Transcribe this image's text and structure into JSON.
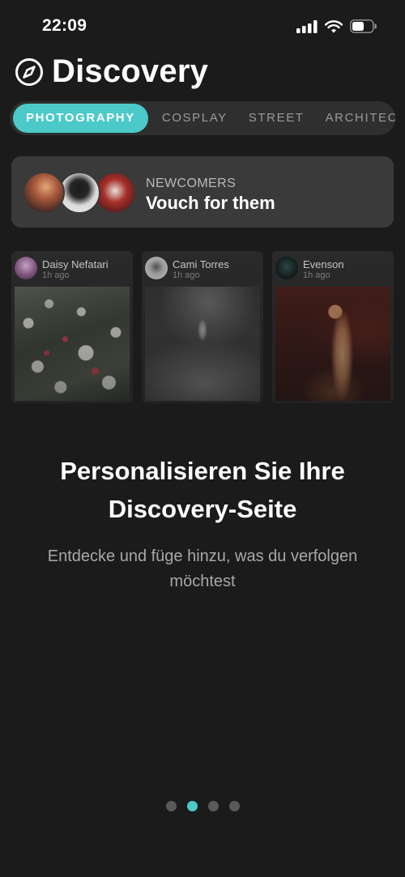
{
  "status_bar": {
    "time": "22:09"
  },
  "header": {
    "title": "Discovery",
    "icon": "compass-icon"
  },
  "tabs": [
    {
      "label": "PHOTOGRAPHY",
      "active": true
    },
    {
      "label": "COSPLAY",
      "active": false
    },
    {
      "label": "STREET",
      "active": false
    },
    {
      "label": "ARCHITEC",
      "active": false
    }
  ],
  "newcomers": {
    "label": "NEWCOMERS",
    "title": "Vouch for them"
  },
  "cards": [
    {
      "name": "Daisy Nefatari",
      "time": "1h ago"
    },
    {
      "name": "Cami Torres",
      "time": "1h ago"
    },
    {
      "name": "Evenson",
      "time": "1h ago"
    }
  ],
  "onboarding": {
    "headline": "Personalisieren Sie Ihre Discovery-Seite",
    "subline": "Entdecke und füge hinzu, was du verfolgen möchtest"
  },
  "pager": {
    "page_count": 4,
    "active_index": 1
  },
  "colors": {
    "accent": "#4cc9c9",
    "background": "#1b1b1b",
    "card": "#3a3a3a"
  }
}
